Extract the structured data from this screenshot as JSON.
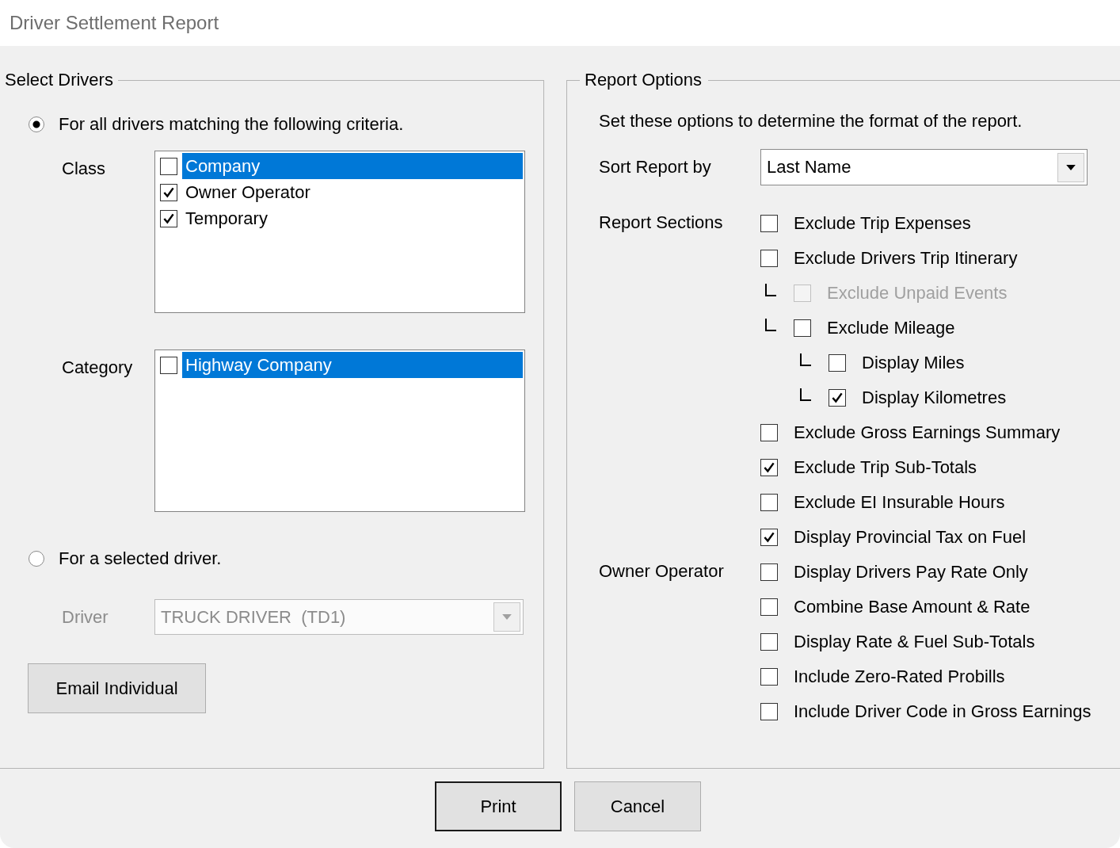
{
  "window": {
    "title": "Driver Settlement Report"
  },
  "select_drivers": {
    "title": "Select Drivers",
    "modes": [
      {
        "label": "For all drivers matching the following criteria.",
        "selected": true
      },
      {
        "label": "For a selected driver.",
        "selected": false
      }
    ],
    "class": {
      "label": "Class",
      "items": [
        {
          "label": "Company",
          "checked": false,
          "selected": true
        },
        {
          "label": "Owner Operator",
          "checked": true,
          "selected": false
        },
        {
          "label": "Temporary",
          "checked": true,
          "selected": false
        }
      ]
    },
    "category": {
      "label": "Category",
      "items": [
        {
          "label": "Highway Company",
          "checked": false,
          "selected": true
        }
      ]
    },
    "driver": {
      "label": "Driver",
      "value": "TRUCK DRIVER  (TD1)",
      "disabled": true
    },
    "email_button": "Email Individual"
  },
  "report_options": {
    "title": "Report Options",
    "intro": "Set these options to determine the format of the report.",
    "sort": {
      "label": "Sort Report by",
      "value": "Last Name"
    },
    "groups": [
      {
        "label": "Report Sections",
        "options": [
          {
            "label": "Exclude Trip Expenses",
            "checked": false,
            "disabled": false
          },
          {
            "label": "Exclude Drivers Trip Itinerary",
            "checked": false,
            "disabled": false,
            "children": [
              {
                "label": "Exclude Unpaid Events",
                "checked": false,
                "disabled": true
              },
              {
                "label": "Exclude Mileage",
                "checked": false,
                "disabled": false,
                "children": [
                  {
                    "label": "Display Miles",
                    "checked": false,
                    "disabled": false
                  },
                  {
                    "label": "Display Kilometres",
                    "checked": true,
                    "disabled": false
                  }
                ]
              }
            ]
          },
          {
            "label": "Exclude Gross Earnings Summary",
            "checked": false,
            "disabled": false
          },
          {
            "label": "Exclude Trip Sub-Totals",
            "checked": true,
            "disabled": false
          },
          {
            "label": "Exclude EI Insurable Hours",
            "checked": false,
            "disabled": false
          },
          {
            "label": "Display Provincial Tax on Fuel",
            "checked": true,
            "disabled": false
          }
        ]
      },
      {
        "label": "Owner Operator",
        "options": [
          {
            "label": "Display Drivers Pay Rate Only",
            "checked": false,
            "disabled": false
          },
          {
            "label": "Combine Base Amount & Rate",
            "checked": false,
            "disabled": false
          },
          {
            "label": "Display Rate & Fuel Sub-Totals",
            "checked": false,
            "disabled": false
          },
          {
            "label": "Include Zero-Rated Probills",
            "checked": false,
            "disabled": false
          },
          {
            "label": "Include Driver Code in Gross Earnings",
            "checked": false,
            "disabled": false
          }
        ]
      }
    ]
  },
  "buttons": [
    {
      "label": "Print",
      "default": true
    },
    {
      "label": "Cancel",
      "default": false
    }
  ]
}
